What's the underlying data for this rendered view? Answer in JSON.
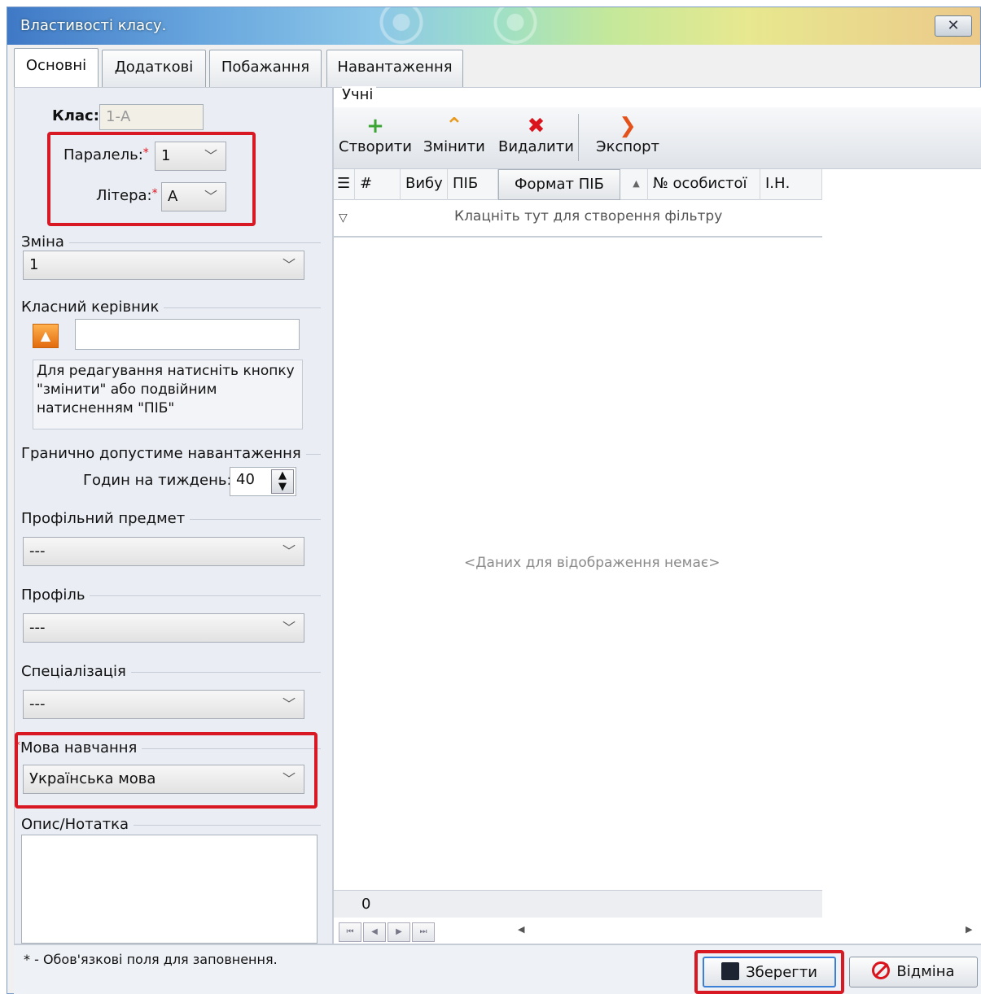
{
  "window": {
    "title": "Властивості класу.",
    "close_label": "✕"
  },
  "tabs": [
    {
      "label": "Основні",
      "active": true
    },
    {
      "label": "Додаткові"
    },
    {
      "label": "Побажання"
    },
    {
      "label": "Навантаження"
    }
  ],
  "class_info": {
    "class_label": "Клас:",
    "class_value": "1-А",
    "parallel_label": "Паралель:",
    "parallel_value": "1",
    "letter_label": "Літера:",
    "letter_value": "А",
    "required_mark": "*"
  },
  "shift": {
    "title": "Зміна",
    "value": "1"
  },
  "class_teacher": {
    "title": "Класний керівник",
    "value": "",
    "hint": "Для редагування натисніть кнопку \"змінити\" або подвійним натисненням \"ПІБ\""
  },
  "max_load": {
    "title": "Гранично допустиме навантаження",
    "hours_label": "Годин на тиждень:",
    "hours_value": "40"
  },
  "profile_subject": {
    "title": "Профільний предмет",
    "value": "---"
  },
  "profile": {
    "title": "Профіль",
    "value": "---"
  },
  "specialization": {
    "title": "Спеціалізація",
    "value": "---"
  },
  "language": {
    "title": "Мова навчання",
    "value": "Українська мова"
  },
  "note": {
    "title": "Опис/Нотатка",
    "value": ""
  },
  "students": {
    "title": "Учні",
    "toolbar": {
      "create": "Створити",
      "edit": "Змінити",
      "delete": "Видалити",
      "export": "Экспорт"
    },
    "columns": [
      "#",
      "Вибу",
      "ПІБ",
      "Формат ПІБ",
      "№ особистої",
      "І.Н."
    ],
    "filter_hint": "Клацніть тут для створення фільтру",
    "empty_message": "<Даних для відображення немає>",
    "footer_count": "0"
  },
  "footer": {
    "required_note": "* - Обов'язкові поля для заповнення.",
    "save": "Зберегти",
    "cancel": "Відміна"
  },
  "colors": {
    "highlight_red": "#d81924",
    "title_blue": "#3f79c6"
  }
}
